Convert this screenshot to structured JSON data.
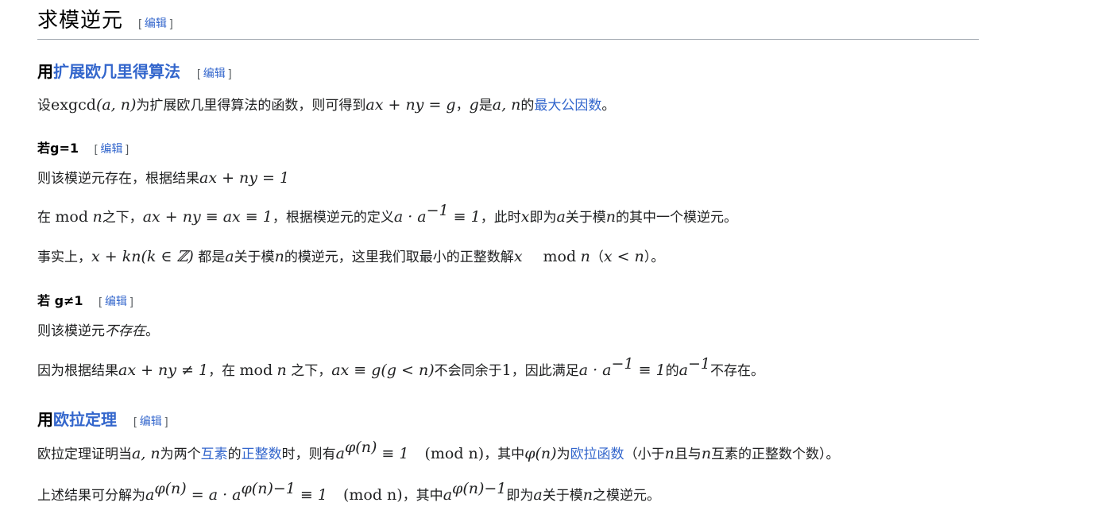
{
  "h2": {
    "title": "求模逆元",
    "edit_open": "[",
    "edit_label": "编辑",
    "edit_close": "]"
  },
  "sec1": {
    "title_prefix": "用",
    "title_link": "扩展欧几里得算法",
    "edit_label": "编辑",
    "p1": {
      "t1": "设",
      "m1": "exgcd",
      "m2": "(a, n)",
      "t2": "为扩展欧几里得算法的函数，则可得到",
      "m3": "ax + ny = g",
      "t3": "，",
      "m4": "g",
      "t4": "是",
      "m5": "a, n",
      "t5": "的",
      "link": "最大公因数",
      "t6": "。"
    }
  },
  "sub1": {
    "title": "若g=1",
    "edit_label": "编辑",
    "p1": {
      "t1": "则该模逆元存在，根据结果",
      "m1": "ax + ny = 1"
    },
    "p2": {
      "t1": "在 ",
      "m1": "mod",
      "m2": "n",
      "t2": "之下，",
      "m3": "ax + ny ≡ ax ≡ 1",
      "t3": "，根据模逆元的定义",
      "m4": "a · a",
      "sup1": "−1",
      "m5": " ≡ 1",
      "t4": "，此时",
      "m6": "x",
      "t5": "即为",
      "m7": "a",
      "t6": "关于模",
      "m8": "n",
      "t7": "的其中一个模逆元。"
    },
    "p3": {
      "t1": "事实上，",
      "m1": "x + kn(k ∈ ℤ)",
      "t2": " 都是",
      "m2": "a",
      "t3": "关于模",
      "m3": "n",
      "t4": "的模逆元，这里我们取最小的正整数解",
      "m4": "x",
      "m5": "mod",
      "m6": "n",
      "t5": "（",
      "m7": "x < n",
      "t6": "）。"
    }
  },
  "sub2": {
    "title": "若 g≠1",
    "edit_label": "编辑",
    "p1": {
      "t1": "则该模逆元",
      "t2": "不存在",
      "t3": "。"
    },
    "p2": {
      "t1": "因为根据结果",
      "m1": "ax + ny ≠ 1",
      "t2": "，在 ",
      "m2": "mod",
      "m3": "n",
      "t3": " 之下，",
      "m4": "ax ≡ g(g < n)",
      "t4": "不会同余于",
      "m5": "1",
      "t5": "，因此满足",
      "m6": "a · a",
      "sup1": "−1",
      "m7": " ≡ 1",
      "t6": "的",
      "m8": "a",
      "sup2": "−1",
      "t7": "不存在。"
    }
  },
  "sec2": {
    "title_prefix": "用",
    "title_link": "欧拉定理",
    "edit_label": "编辑",
    "p1": {
      "t1": "欧拉定理证明当",
      "m1": "a, n",
      "t2": "为两个",
      "link1": "互素",
      "t3": "的",
      "link2": "正整数",
      "t4": "时，则有",
      "m2": "a",
      "sup1": "φ(n)",
      "m3": " ≡ 1",
      "m4": "(mod  n)",
      "t5": "，其中",
      "m5": "φ(n)",
      "t6": "为",
      "link3": "欧拉函数",
      "t7": "（小于",
      "m6": "n",
      "t8": "且与",
      "m7": "n",
      "t9": "互素的正整数个数）。"
    },
    "p2": {
      "t1": "上述结果可分解为",
      "m1": "a",
      "sup1": "φ(n)",
      "m2": " = a · a",
      "sup2": "φ(n)−1",
      "m3": " ≡ 1",
      "m4": "(mod  n)",
      "t2": "，其中",
      "m5": "a",
      "sup3": "φ(n)−1",
      "t3": "即为",
      "m6": "a",
      "t4": "关于模",
      "m7": "n",
      "t5": "之模逆元。"
    }
  }
}
